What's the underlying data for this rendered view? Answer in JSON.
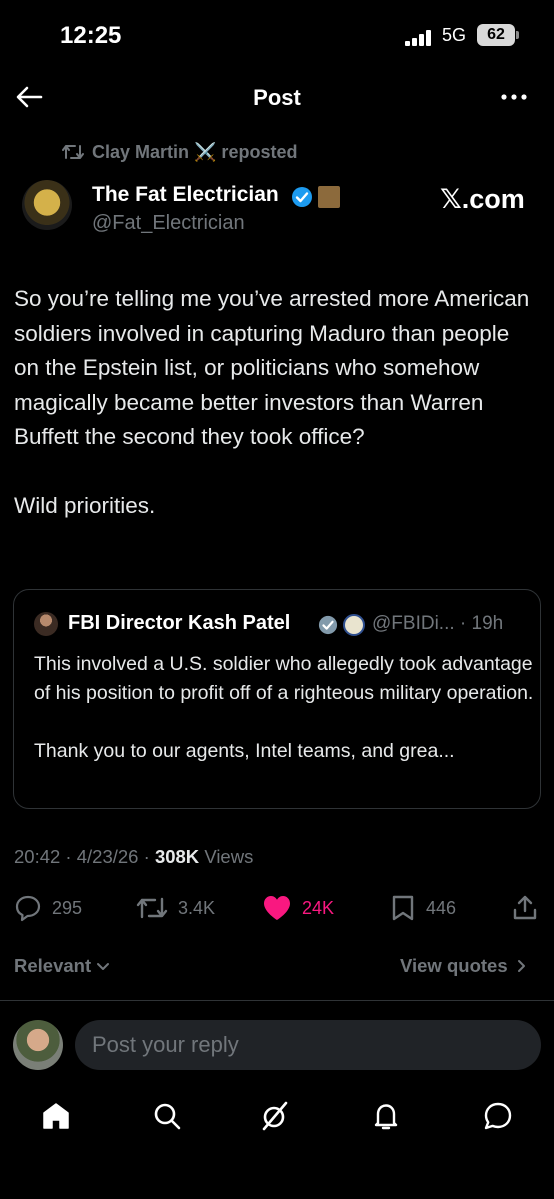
{
  "status_bar": {
    "time": "12:25",
    "network": "5G",
    "battery": "62"
  },
  "topbar": {
    "title": "Post"
  },
  "repost": {
    "text": "Clay Martin ⚔️ reposted"
  },
  "author": {
    "name": "The Fat Electrician",
    "handle": "@Fat_Electrician",
    "source": "𝕏.com"
  },
  "post": {
    "paragraphs": [
      "So you’re telling me you’ve arrested more American soldiers involved in capturing Maduro than people on the Epstein list, or politicians who somehow magically became better investors than Warren Buffett the second they took office?",
      "Wild priorities."
    ],
    "time": "20:42",
    "date": "4/23/26",
    "views_count": "308K",
    "views_label": "Views"
  },
  "quote": {
    "name": "FBI Director Kash Patel",
    "handle": "@FBIDi...",
    "age": "19h",
    "paragraphs": [
      "This involved a U.S. soldier who allegedly took advantage of his position to profit off of a righteous military operation.",
      "Thank you to our agents, Intel teams, and grea..."
    ]
  },
  "actions": {
    "replies": "295",
    "reposts": "3.4K",
    "likes": "24K",
    "bookmarks": "446"
  },
  "replies_filter": {
    "sort": "Relevant",
    "view_quotes": "View quotes"
  },
  "reply_box": {
    "placeholder": "Post your reply"
  },
  "colors": {
    "background": "#000000",
    "text": "#e7e9ea",
    "muted": "#71767b",
    "like": "#f91880",
    "verified": "#1d9bf0",
    "border": "#2f3336"
  },
  "icons": [
    "back-arrow-icon",
    "more-icon",
    "repost-icon",
    "verified-icon",
    "reply-icon",
    "heart-icon",
    "bookmark-icon",
    "share-icon",
    "home-icon",
    "search-icon",
    "grok-icon",
    "notifications-icon",
    "messages-icon"
  ]
}
